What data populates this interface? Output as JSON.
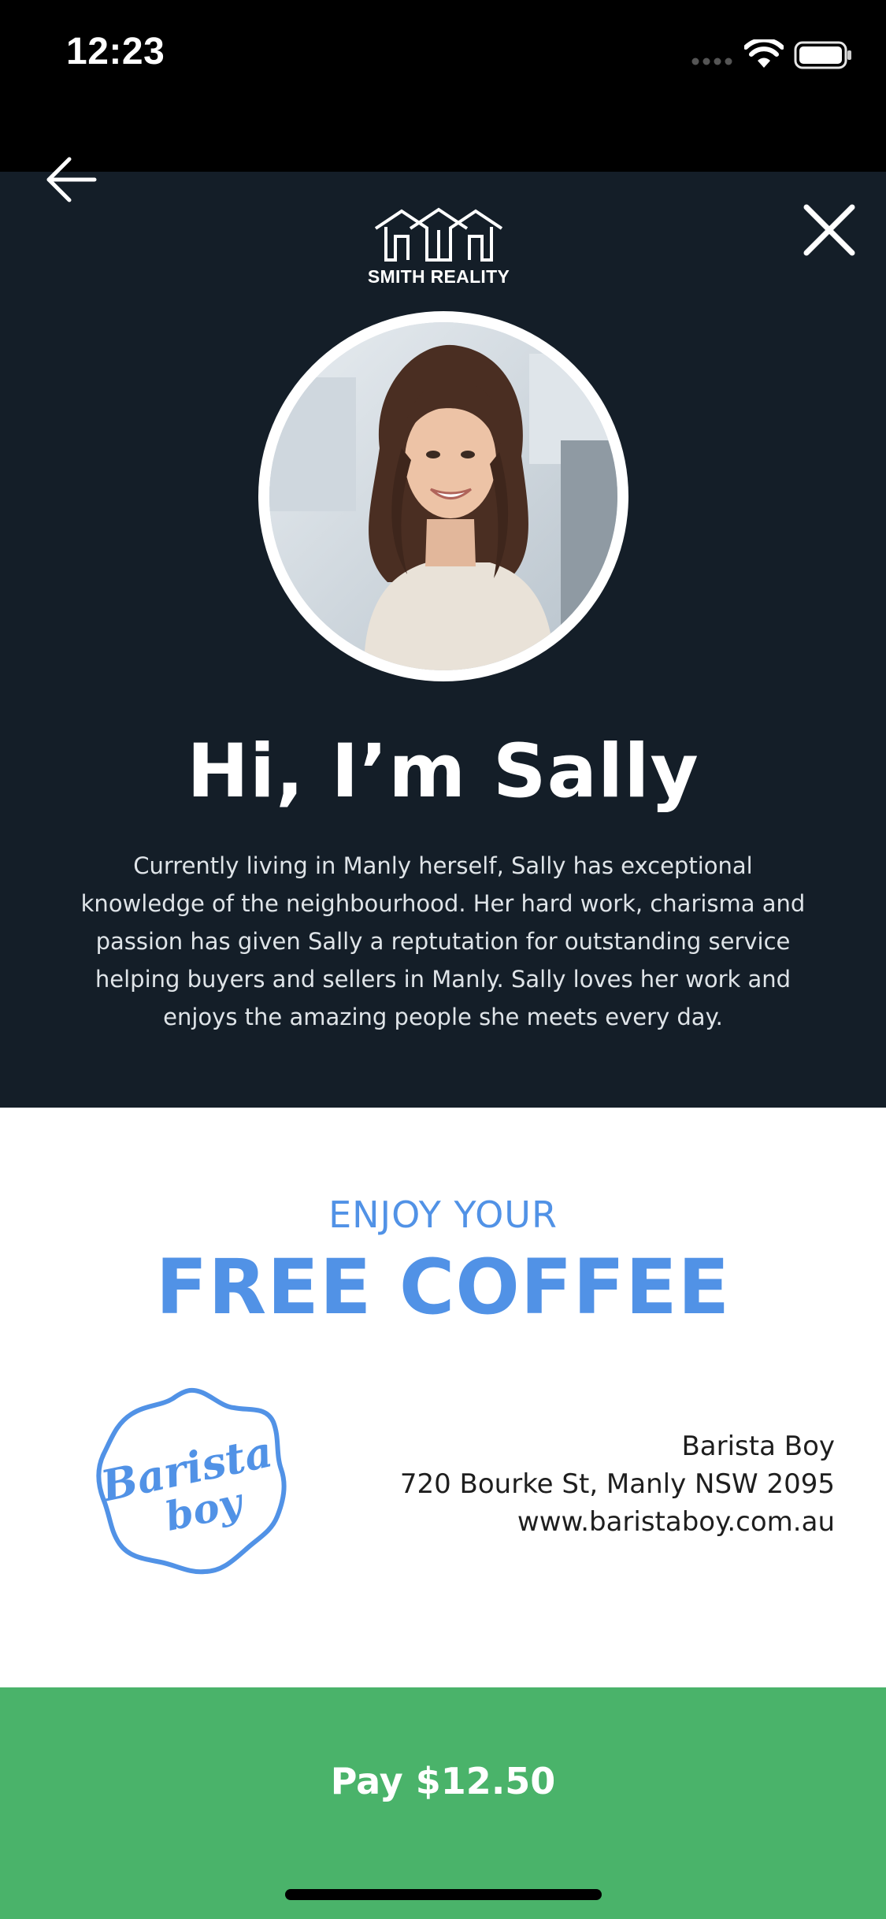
{
  "status_bar": {
    "time": "12:23"
  },
  "header": {
    "brand_name": "SMITH REALITY"
  },
  "profile": {
    "greeting": "Hi, I’m Sally",
    "bio": "Currently living in Manly herself, Sally has exceptional knowledge of the neighbourhood. Her hard work, charisma and passion has given Sally a reptutation for outstanding service helping buyers and sellers in Manly. Sally loves her work and enjoys the amazing people she meets every day."
  },
  "offer": {
    "eyebrow": "ENJOY YOUR",
    "title": "FREE COFFEE",
    "merchant": {
      "logo_text_line1": "Barista",
      "logo_text_line2": "boy",
      "name": "Barista Boy",
      "address": "720 Bourke St, Manly NSW 2095",
      "website": "www.baristaboy.com.au"
    }
  },
  "pay_button": {
    "label": "Pay $12.50"
  },
  "colors": {
    "hero_background": "#141e28",
    "accent_blue": "#5192e6",
    "pay_green": "#4ab36a"
  },
  "icons": {
    "back": "arrow-left-icon",
    "close": "close-icon",
    "signal": "cellular-signal-icon",
    "wifi": "wifi-icon",
    "battery": "battery-icon",
    "brand": "house-roof-logo"
  }
}
